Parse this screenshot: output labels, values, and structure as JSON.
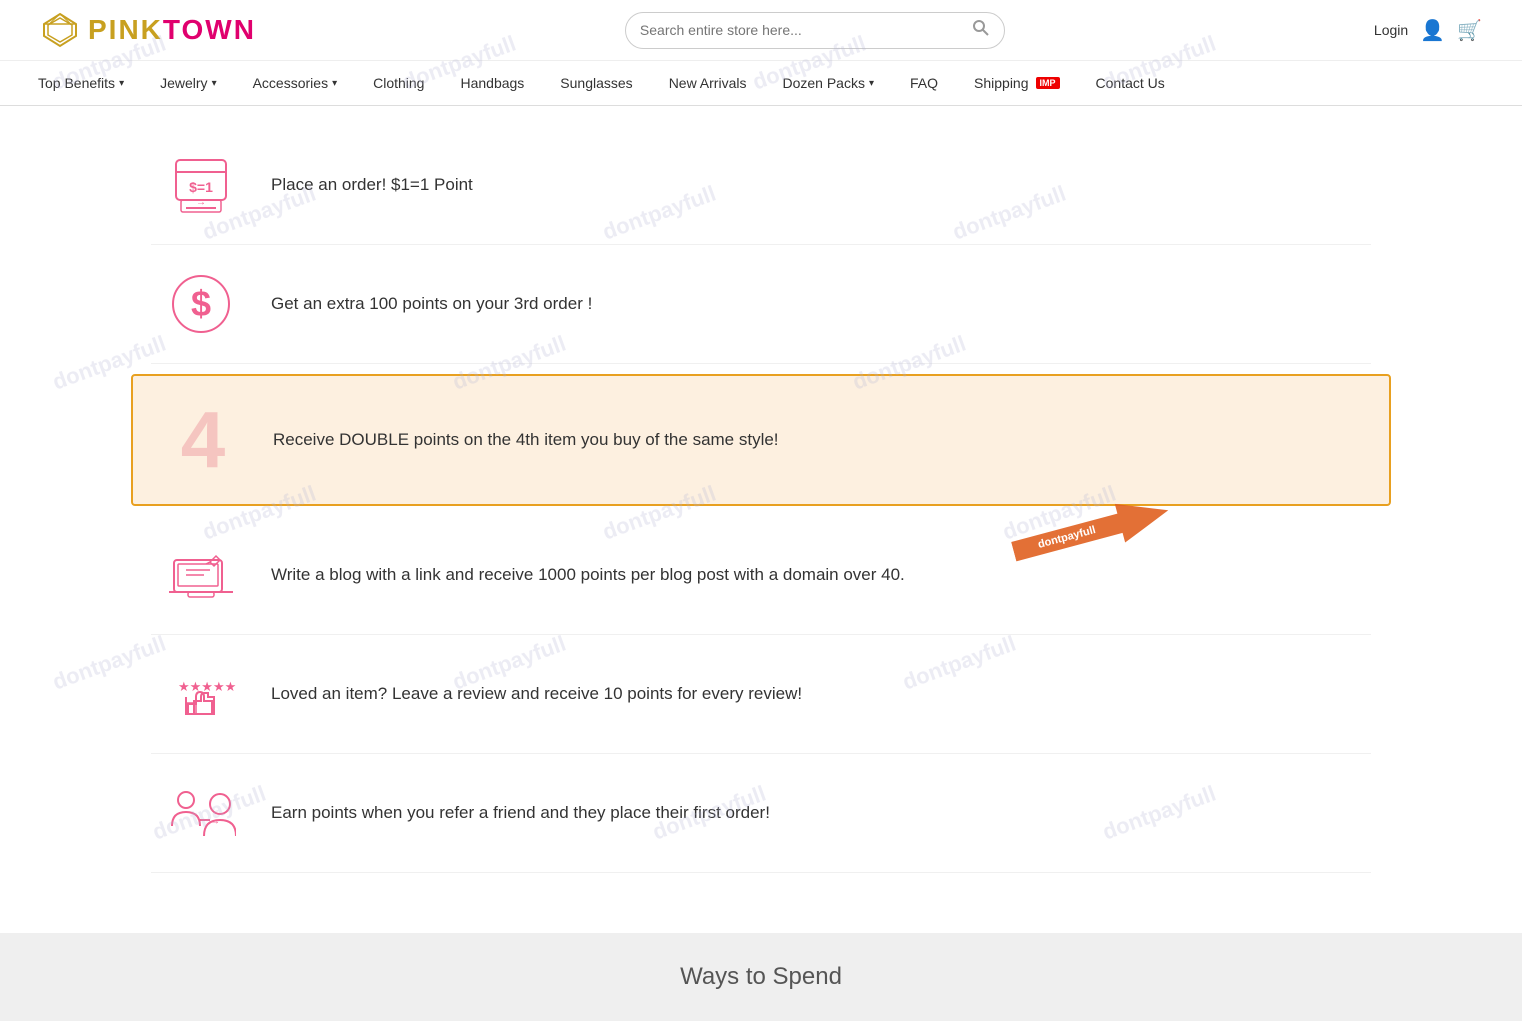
{
  "header": {
    "logo_gold": "PINK",
    "logo_pink": "TOWN",
    "search_placeholder": "Search entire store here...",
    "login_label": "Login",
    "actions": {
      "user_icon": "👤",
      "cart_icon": "🛒"
    }
  },
  "nav": {
    "items": [
      {
        "label": "Top Benefits",
        "has_dropdown": true
      },
      {
        "label": "Jewelry",
        "has_dropdown": true
      },
      {
        "label": "Accessories",
        "has_dropdown": true
      },
      {
        "label": "Clothing",
        "has_dropdown": false
      },
      {
        "label": "Handbags",
        "has_dropdown": false
      },
      {
        "label": "Sunglasses",
        "has_dropdown": false
      },
      {
        "label": "New Arrivals",
        "has_dropdown": false
      },
      {
        "label": "Dozen Packs",
        "has_dropdown": true
      },
      {
        "label": "FAQ",
        "has_dropdown": false
      },
      {
        "label": "Shipping",
        "has_dropdown": false,
        "badge": "IMP"
      },
      {
        "label": "Contact Us",
        "has_dropdown": false
      }
    ]
  },
  "benefits": [
    {
      "id": "order-points",
      "icon_type": "order",
      "text": "Place an order! $1=1 Point",
      "highlighted": false
    },
    {
      "id": "third-order",
      "icon_type": "dollar",
      "text": "Get an extra 100 points on your 3rd order !",
      "highlighted": false
    },
    {
      "id": "double-points",
      "icon_type": "number4",
      "text": "Receive DOUBLE points on the 4th item you buy of the same style!",
      "highlighted": true
    },
    {
      "id": "blog",
      "icon_type": "blog",
      "text": "Write a blog with a link and receive 1000 points per blog post with a domain over 40.",
      "highlighted": false
    },
    {
      "id": "review",
      "icon_type": "review",
      "text": "Loved an item? Leave a review and receive 10 points for every review!",
      "highlighted": false
    },
    {
      "id": "referral",
      "icon_type": "referral",
      "text": "Earn points when you refer a friend and they place their first order!",
      "highlighted": false
    }
  ],
  "footer": {
    "ways_to_spend_label": "Ways to Spend"
  },
  "watermark": {
    "text": "dontpayfull"
  }
}
